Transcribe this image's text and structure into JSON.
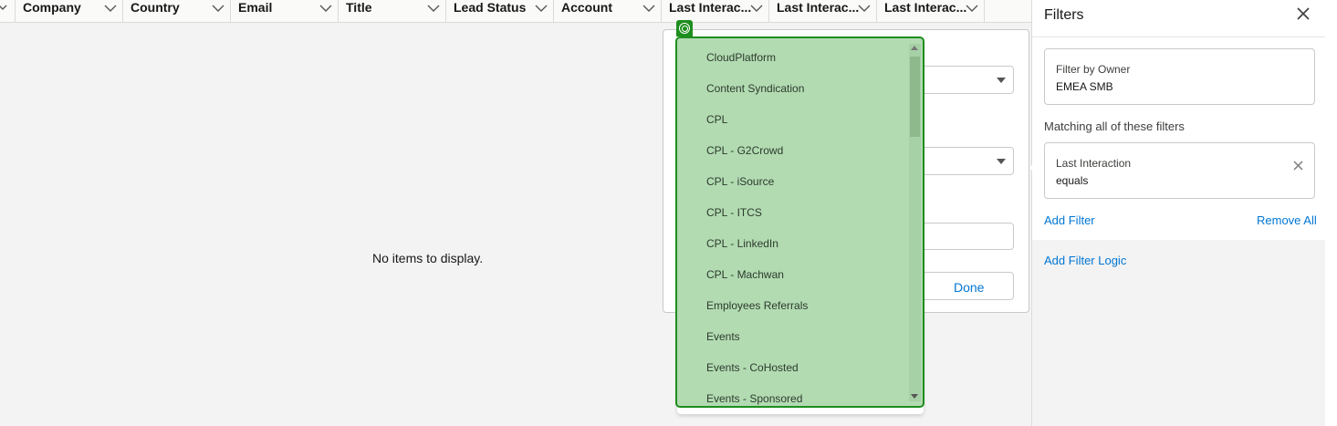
{
  "table": {
    "columns": [
      {
        "label": ""
      },
      {
        "label": "Company"
      },
      {
        "label": "Country"
      },
      {
        "label": "Email"
      },
      {
        "label": "Title"
      },
      {
        "label": "Lead Status"
      },
      {
        "label": "Account"
      },
      {
        "label": "Last Interac..."
      },
      {
        "label": "Last Interac..."
      },
      {
        "label": "Last Interac..."
      }
    ],
    "empty_message": "No items to display."
  },
  "popover": {
    "done_label": "Done"
  },
  "dropdown": {
    "options": [
      "CloudPlatform",
      "Content Syndication",
      "CPL",
      "CPL - G2Crowd",
      "CPL - iSource",
      "CPL - ITCS",
      "CPL - LinkedIn",
      "CPL - Machwan",
      "Employees Referrals",
      "Events",
      "Events - CoHosted",
      "Events - Sponsored"
    ],
    "highlight_color": "#b2dbb2",
    "border_color": "#1e8e1e"
  },
  "filters_panel": {
    "title": "Filters",
    "owner_filter": {
      "label": "Filter by Owner",
      "value": "EMEA SMB"
    },
    "matching_label": "Matching all of these filters",
    "criteria": [
      {
        "field": "Last Interaction",
        "operator": "equals"
      }
    ],
    "add_filter_label": "Add Filter",
    "remove_all_label": "Remove All",
    "add_logic_label": "Add Filter Logic",
    "link_color": "#0176d3"
  }
}
